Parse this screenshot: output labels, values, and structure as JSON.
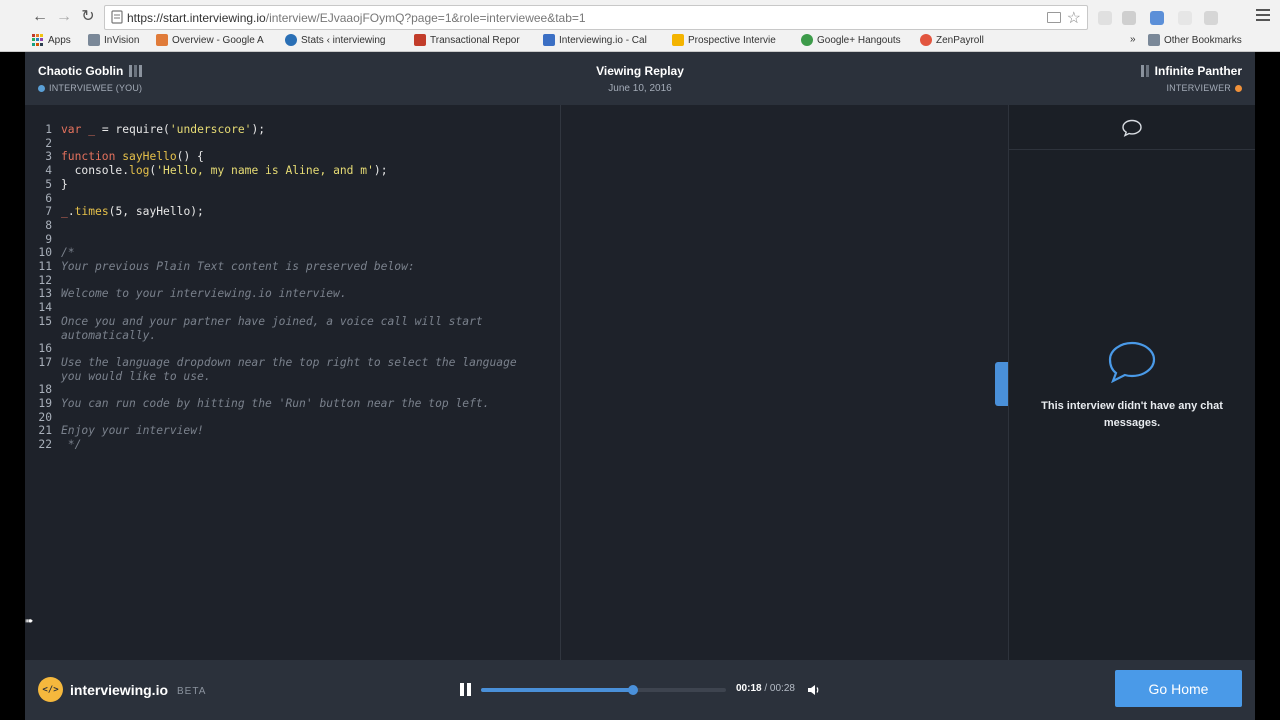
{
  "browser": {
    "url_host": "https://start.interviewing.io",
    "url_path": "/interview/EJvaaojFOymQ?page=1&role=interviewee&tab=1",
    "bookmarks": [
      {
        "label": "Apps",
        "color": "#4285f4"
      },
      {
        "label": "InVision",
        "color": "#7a8898"
      },
      {
        "label": "Overview - Google A",
        "color": "#e07b39"
      },
      {
        "label": "Stats ‹ interviewing",
        "color": "#2a6fb5"
      },
      {
        "label": "Transactional Repor",
        "color": "#c23c2a"
      },
      {
        "label": "Interviewing.io - Cal",
        "color": "#3b6fc4"
      },
      {
        "label": "Prospective Intervie",
        "color": "#f4b400"
      },
      {
        "label": "Google+ Hangouts",
        "color": "#3d9b4a"
      },
      {
        "label": "ZenPayroll",
        "color": "#e2553f"
      }
    ],
    "other_bookmarks": "Other Bookmarks",
    "more": "»"
  },
  "header": {
    "left_user": {
      "name": "Chaotic Goblin",
      "role": "INTERVIEWEE (YOU)",
      "status_color": "#5a9fd6"
    },
    "center": {
      "title": "Viewing Replay",
      "date": "June 10, 2016"
    },
    "right_user": {
      "name": "Infinite Panther",
      "role": "INTERVIEWER",
      "status_color": "#f0913a"
    }
  },
  "editor": {
    "lines": [
      {
        "n": "1",
        "code": "var _ = require('underscore');",
        "kind": "code"
      },
      {
        "n": "2",
        "code": "",
        "kind": "code"
      },
      {
        "n": "3",
        "code": "function sayHello() {",
        "kind": "code"
      },
      {
        "n": "4",
        "code": "  console.log('Hello, my name is Aline, and m');",
        "kind": "code"
      },
      {
        "n": "5",
        "code": "}",
        "kind": "code"
      },
      {
        "n": "6",
        "code": "",
        "kind": "code"
      },
      {
        "n": "7",
        "code": "_.times(5, sayHello);",
        "kind": "code"
      },
      {
        "n": "8",
        "code": "",
        "kind": "code"
      },
      {
        "n": "9",
        "code": "",
        "kind": "code"
      },
      {
        "n": "10",
        "code": "/*",
        "kind": "comment"
      },
      {
        "n": "11",
        "code": "Your previous Plain Text content is preserved below:",
        "kind": "comment"
      },
      {
        "n": "12",
        "code": "",
        "kind": "comment"
      },
      {
        "n": "13",
        "code": "Welcome to your interviewing.io interview.",
        "kind": "comment"
      },
      {
        "n": "14",
        "code": "",
        "kind": "comment"
      },
      {
        "n": "15",
        "code": "Once you and your partner have joined, a voice call will start",
        "kind": "comment"
      },
      {
        "n": "",
        "code": "automatically.",
        "kind": "comment"
      },
      {
        "n": "16",
        "code": "",
        "kind": "comment"
      },
      {
        "n": "17",
        "code": "Use the language dropdown near the top right to select the language",
        "kind": "comment"
      },
      {
        "n": "",
        "code": "you would like to use.",
        "kind": "comment"
      },
      {
        "n": "18",
        "code": "",
        "kind": "comment"
      },
      {
        "n": "19",
        "code": "You can run code by hitting the 'Run' button near the top left.",
        "kind": "comment"
      },
      {
        "n": "20",
        "code": "",
        "kind": "comment"
      },
      {
        "n": "21",
        "code": "Enjoy your interview!",
        "kind": "comment"
      },
      {
        "n": "22",
        "code": " */",
        "kind": "comment"
      }
    ]
  },
  "chat": {
    "empty_message": "This interview didn't have any chat messages."
  },
  "footer": {
    "logo_badge": "</>",
    "brand": "interviewing.io",
    "beta": "BETA",
    "progress": 0.62,
    "time_current": "00:18",
    "time_separator": " / ",
    "time_total": "00:28",
    "go_home_label": "Go Home"
  },
  "colors": {
    "accent": "#4a90d9",
    "app_bg": "#1e222a",
    "header_bg": "#2b313b",
    "logo_yellow": "#f5b83d"
  }
}
